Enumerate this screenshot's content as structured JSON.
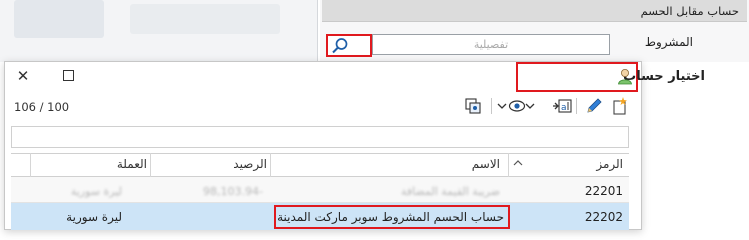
{
  "app": {
    "section_title": "حساب مقابل الحسم",
    "condition_label": "المشروط",
    "condition_placeholder": "تفصيلية"
  },
  "dialog": {
    "title": "اختيار حساب",
    "counter": "106 / 100",
    "columns": {
      "code": "الرمز",
      "name": "الاسم",
      "balance": "الرصيد",
      "currency": "العملة"
    },
    "rows": [
      {
        "code": "22201",
        "name": "ضريبة القيمة المضافة",
        "balance": "98,103.94-",
        "currency": "ليرة سورية"
      },
      {
        "code": "22202",
        "name": "حساب الحسم المشروط سوبر ماركت المدينة",
        "balance": "",
        "currency": "ليرة سورية"
      }
    ]
  },
  "colors": {
    "highlight_border": "#e0191e",
    "selected_row": "#cde4f7"
  },
  "icons": [
    "search-icon",
    "close-icon",
    "maximize-icon",
    "user-account-icon",
    "new-item-icon",
    "edit-icon",
    "text-replace-icon",
    "view-icon",
    "chevron-down-icon",
    "copy-icon",
    "sort-ascending-icon"
  ]
}
